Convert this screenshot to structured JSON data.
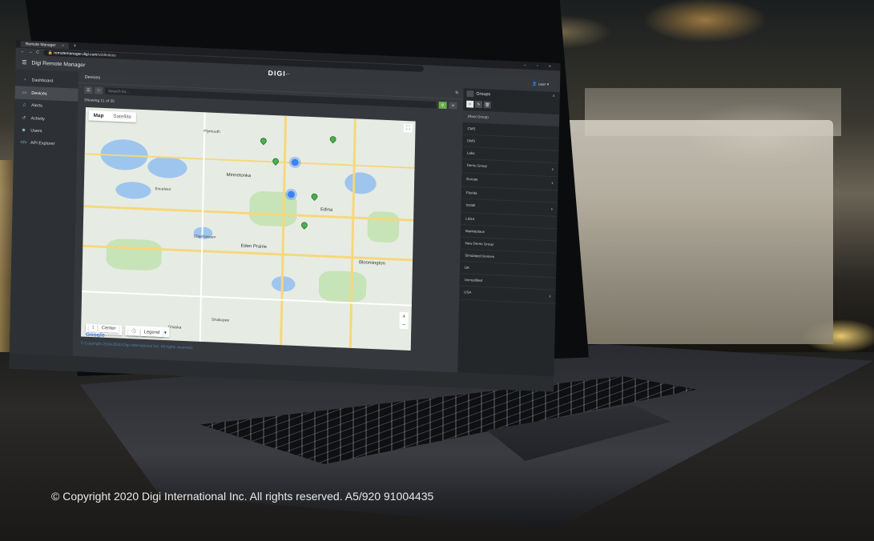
{
  "credit": "© Copyright 2020 Digi International Inc. All rights reserved. A5/920 91004435",
  "browser": {
    "tab_label": "Remote Manager",
    "url_host": "remotemanager.digi.com",
    "url_path": "/ui/devices"
  },
  "app": {
    "title": "Digi Remote Manager",
    "brand": "DIGI",
    "user": "user"
  },
  "sidebar": {
    "items": [
      {
        "label": "Dashboard",
        "icon": "gauge-icon"
      },
      {
        "label": "Devices",
        "icon": "device-icon"
      },
      {
        "label": "Alerts",
        "icon": "bell-icon"
      },
      {
        "label": "Activity",
        "icon": "history-icon"
      },
      {
        "label": "Users",
        "icon": "users-icon"
      },
      {
        "label": "API Explorer",
        "icon": "code-icon"
      }
    ]
  },
  "devices": {
    "header": "Devices",
    "search_placeholder": "Search for...",
    "showing": "Showing 11 of 35"
  },
  "map": {
    "type_map": "Map",
    "type_satellite": "Satellite",
    "center_label": "Center",
    "legend_label": "Legend",
    "google": "Google",
    "labels": {
      "minnetonka": "Minnetonka",
      "edina": "Edina",
      "eden_prairie": "Eden Prairie",
      "bloomington": "Bloomington",
      "chaska": "Chaska",
      "shakopee": "Shakopee",
      "chanhassen": "Chanhassen",
      "excelsior": "Excelsior",
      "plymouth": "Plymouth"
    }
  },
  "footer": "© Copyright 2014-2020 Digi International Inc. All rights reserved.",
  "groups": {
    "header": "Groups",
    "items": [
      {
        "label": "(Root Group)",
        "chevron": false
      },
      {
        "label": "CMS",
        "chevron": false
      },
      {
        "label": "DMS",
        "chevron": false
      },
      {
        "label": "Labs",
        "chevron": false
      },
      {
        "label": "Demo Group",
        "chevron": true
      },
      {
        "label": "Europe",
        "chevron": true
      },
      {
        "label": "Florida",
        "chevron": false
      },
      {
        "label": "Install",
        "chevron": true
      },
      {
        "label": "LIDIA",
        "chevron": false
      },
      {
        "label": "Marketplace",
        "chevron": false
      },
      {
        "label": "New Demo Group",
        "chevron": false
      },
      {
        "label": "Simulated Devices",
        "chevron": false
      },
      {
        "label": "UK",
        "chevron": false
      },
      {
        "label": "Unmodified",
        "chevron": false
      },
      {
        "label": "USA",
        "chevron": true
      }
    ]
  }
}
